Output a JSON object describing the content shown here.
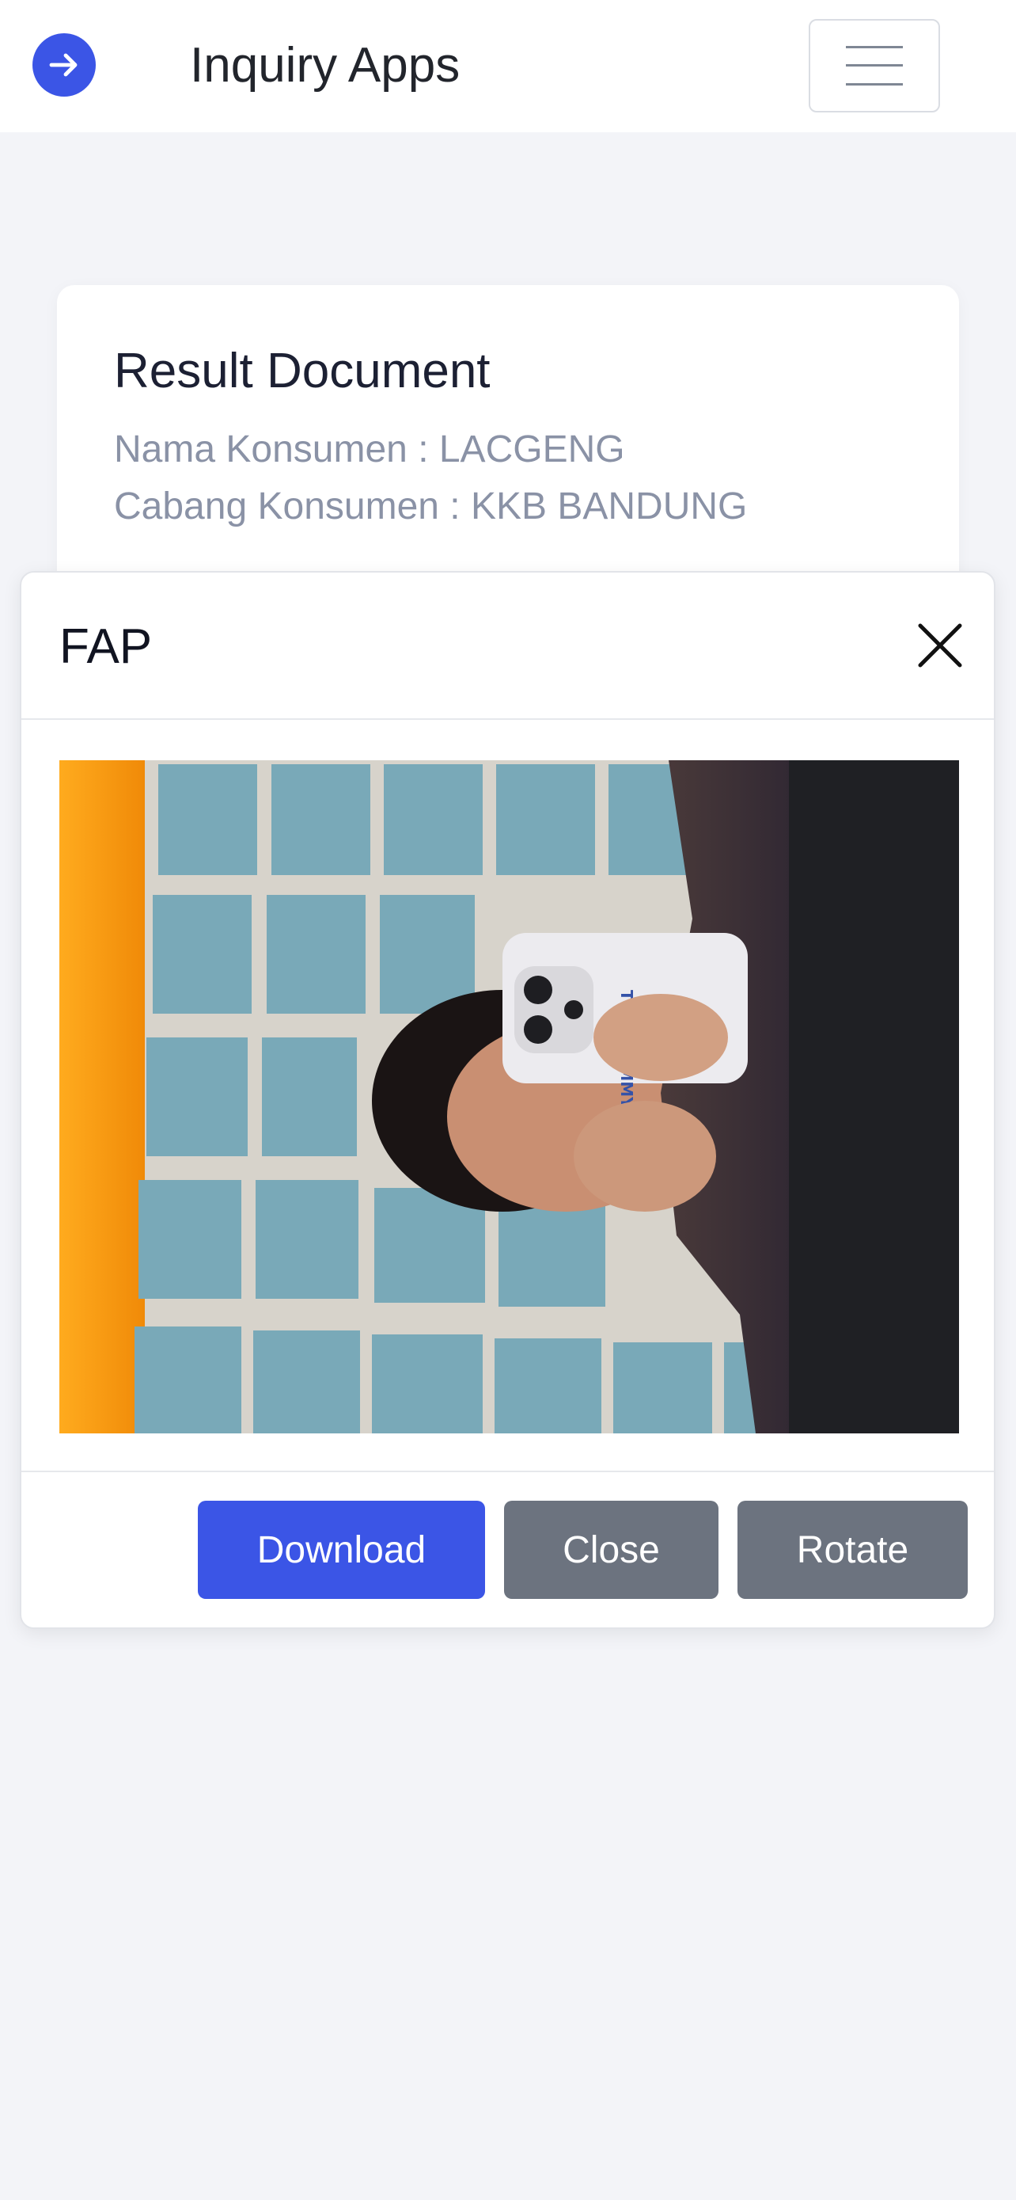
{
  "navbar": {
    "logo_icon": "arrow-right-circle-icon",
    "title": "Inquiry Apps",
    "menu_icon": "hamburger-menu-icon",
    "accent_color": "#3b55e6"
  },
  "result_card": {
    "title": "Result Document",
    "customer_name_line": "Nama Konsumen : LACGENG",
    "customer_branch_line": "Cabang Konsumen : KKB BANDUNG"
  },
  "modal": {
    "title": "FAP",
    "close_icon": "close-x-icon",
    "image": {
      "phone_case_text": "TEDDY JIMMY"
    },
    "buttons": {
      "download_label": "Download",
      "close_label": "Close",
      "rotate_label": "Rotate"
    },
    "colors": {
      "primary": "#3b55e6",
      "secondary": "#6c737f"
    }
  }
}
